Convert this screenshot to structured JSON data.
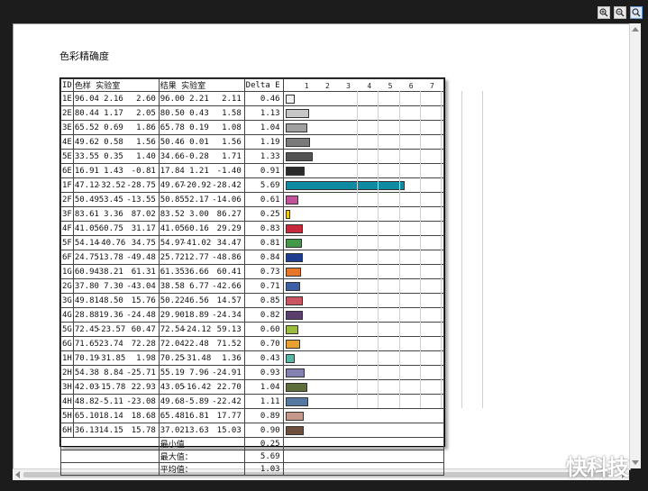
{
  "title": "色彩精确度",
  "toolbar": {
    "buttons": [
      {
        "name": "zoom-in-button",
        "icon": "zoom-in-icon"
      },
      {
        "name": "zoom-out-button",
        "icon": "zoom-out-icon"
      },
      {
        "name": "zoom-fit-button",
        "icon": "zoom-fit-icon"
      }
    ]
  },
  "header": {
    "id": "ID",
    "sample": "色样 实验室",
    "result": "结果 实验室",
    "delta": "Delta E",
    "ticks": [
      "1",
      "2",
      "3",
      "4",
      "5",
      "6",
      "7"
    ]
  },
  "rows": [
    {
      "id": "1E",
      "s": [
        "96.04",
        "2.16",
        "2.60"
      ],
      "r": [
        "96.00",
        "2.21",
        "2.11"
      ],
      "de": "0.46",
      "color": "#f2f2f2"
    },
    {
      "id": "2E",
      "s": [
        "80.44",
        "1.17",
        "2.05"
      ],
      "r": [
        "80.50",
        "0.43",
        "1.58"
      ],
      "de": "1.13",
      "color": "#c6c6c6"
    },
    {
      "id": "3E",
      "s": [
        "65.52",
        "0.69",
        "1.86"
      ],
      "r": [
        "65.78",
        "0.19",
        "1.08"
      ],
      "de": "1.04",
      "color": "#a0a0a0"
    },
    {
      "id": "4E",
      "s": [
        "49.62",
        "0.58",
        "1.56"
      ],
      "r": [
        "50.46",
        "0.01",
        "1.56"
      ],
      "de": "1.19",
      "color": "#7a7a7a"
    },
    {
      "id": "5E",
      "s": [
        "33.55",
        "0.35",
        "1.40"
      ],
      "r": [
        "34.66",
        "-0.28",
        "1.71"
      ],
      "de": "1.33",
      "color": "#545454"
    },
    {
      "id": "6E",
      "s": [
        "16.91",
        "1.43",
        "-0.81"
      ],
      "r": [
        "17.84",
        "1.21",
        "-1.40"
      ],
      "de": "0.91",
      "color": "#2a2a2a"
    },
    {
      "id": "1F",
      "s": [
        "47.12",
        "-32.52",
        "-28.75"
      ],
      "r": [
        "49.67",
        "-20.92",
        "-28.42"
      ],
      "de": "5.69",
      "color": "#0f8aa3"
    },
    {
      "id": "2F",
      "s": [
        "50.49",
        "53.45",
        "-13.55"
      ],
      "r": [
        "50.85",
        "52.17",
        "-14.06"
      ],
      "de": "0.61",
      "color": "#c2539a"
    },
    {
      "id": "3F",
      "s": [
        "83.61",
        "3.36",
        "87.02"
      ],
      "r": [
        "83.52",
        "3.00",
        "86.27"
      ],
      "de": "0.25",
      "color": "#f4c610"
    },
    {
      "id": "4F",
      "s": [
        "41.05",
        "60.75",
        "31.17"
      ],
      "r": [
        "41.05",
        "60.16",
        "29.29"
      ],
      "de": "0.83",
      "color": "#c8283c"
    },
    {
      "id": "5F",
      "s": [
        "54.14",
        "-40.76",
        "34.75"
      ],
      "r": [
        "54.97",
        "-41.02",
        "34.47"
      ],
      "de": "0.81",
      "color": "#409a48"
    },
    {
      "id": "6F",
      "s": [
        "24.75",
        "13.78",
        "-49.48"
      ],
      "r": [
        "25.72",
        "12.77",
        "-48.86"
      ],
      "de": "0.84",
      "color": "#1e3c90"
    },
    {
      "id": "1G",
      "s": [
        "60.94",
        "38.21",
        "61.31"
      ],
      "r": [
        "61.35",
        "36.66",
        "60.41"
      ],
      "de": "0.73",
      "color": "#e7762a"
    },
    {
      "id": "2G",
      "s": [
        "37.80",
        "7.30",
        "-43.04"
      ],
      "r": [
        "38.58",
        "6.77",
        "-42.66"
      ],
      "de": "0.71",
      "color": "#3d5fa3"
    },
    {
      "id": "3G",
      "s": [
        "49.81",
        "48.50",
        "15.76"
      ],
      "r": [
        "50.22",
        "46.56",
        "14.57"
      ],
      "de": "0.85",
      "color": "#c95462"
    },
    {
      "id": "4G",
      "s": [
        "28.88",
        "19.36",
        "-24.48"
      ],
      "r": [
        "29.90",
        "18.89",
        "-24.34"
      ],
      "de": "0.82",
      "color": "#5b3d6e"
    },
    {
      "id": "5G",
      "s": [
        "72.45",
        "-23.57",
        "60.47"
      ],
      "r": [
        "72.54",
        "-24.12",
        "59.13"
      ],
      "de": "0.60",
      "color": "#9bbb3c"
    },
    {
      "id": "6G",
      "s": [
        "71.65",
        "23.74",
        "72.28"
      ],
      "r": [
        "72.04",
        "22.48",
        "71.52"
      ],
      "de": "0.70",
      "color": "#e8a030"
    },
    {
      "id": "1H",
      "s": [
        "70.19",
        "-31.85",
        "1.98"
      ],
      "r": [
        "70.25",
        "-31.48",
        "1.36"
      ],
      "de": "0.43",
      "color": "#56b7a6"
    },
    {
      "id": "2H",
      "s": [
        "54.38",
        "8.84",
        "-25.71"
      ],
      "r": [
        "55.19",
        "7.96",
        "-24.91"
      ],
      "de": "0.93",
      "color": "#8380b2"
    },
    {
      "id": "3H",
      "s": [
        "42.03",
        "-15.78",
        "22.93"
      ],
      "r": [
        "43.05",
        "-16.42",
        "22.70"
      ],
      "de": "1.04",
      "color": "#5d6d3c"
    },
    {
      "id": "4H",
      "s": [
        "48.82",
        "-5.11",
        "-23.08"
      ],
      "r": [
        "49.68",
        "-5.89",
        "-22.42"
      ],
      "de": "1.11",
      "color": "#5478a0"
    },
    {
      "id": "5H",
      "s": [
        "65.10",
        "18.14",
        "18.68"
      ],
      "r": [
        "65.48",
        "16.81",
        "17.77"
      ],
      "de": "0.89",
      "color": "#c5968a"
    },
    {
      "id": "6H",
      "s": [
        "36.13",
        "14.15",
        "15.78"
      ],
      "r": [
        "37.02",
        "13.63",
        "15.03"
      ],
      "de": "0.90",
      "color": "#6e4e3c"
    }
  ],
  "summary": [
    {
      "label": "最小值",
      "value": "0.25"
    },
    {
      "label": "最大值：",
      "value": "5.69"
    },
    {
      "label": "平均值：",
      "value": "1.03"
    }
  ],
  "chart_data": {
    "type": "bar",
    "categories": [
      "1E",
      "2E",
      "3E",
      "4E",
      "5E",
      "6E",
      "1F",
      "2F",
      "3F",
      "4F",
      "5F",
      "6F",
      "1G",
      "2G",
      "3G",
      "4G",
      "5G",
      "6G",
      "1H",
      "2H",
      "3H",
      "4H",
      "5H",
      "6H"
    ],
    "values": [
      0.46,
      1.13,
      1.04,
      1.19,
      1.33,
      0.91,
      5.69,
      0.61,
      0.25,
      0.83,
      0.81,
      0.84,
      0.73,
      0.71,
      0.85,
      0.82,
      0.6,
      0.7,
      0.43,
      0.93,
      1.04,
      1.11,
      0.89,
      0.9
    ],
    "xlabel": "Delta E",
    "xlim": [
      0,
      8
    ],
    "orientation": "horizontal"
  },
  "watermark": "快科技"
}
